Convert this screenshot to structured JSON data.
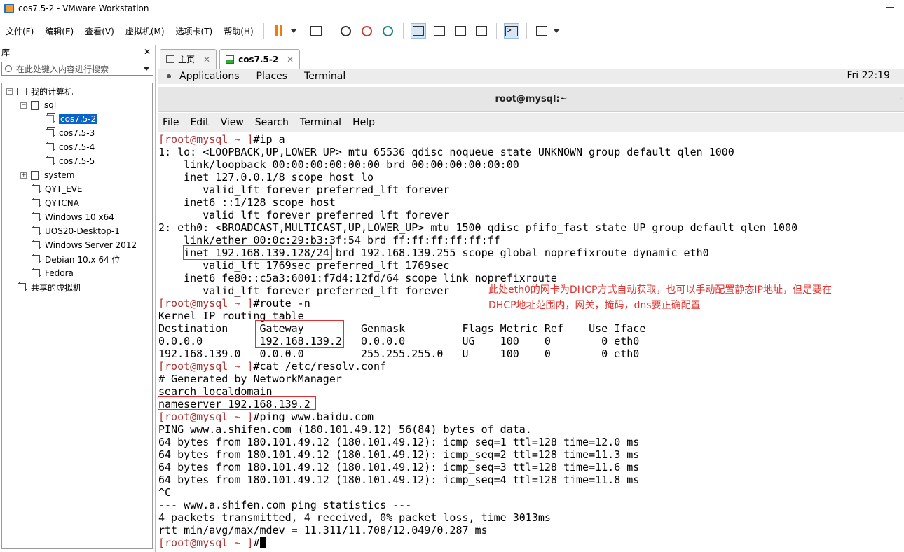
{
  "window": {
    "title": "cos7.5-2 - VMware Workstation"
  },
  "menu": [
    "文件(F)",
    "编辑(E)",
    "查看(V)",
    "虚拟机(M)",
    "选项卡(T)",
    "帮助(H)"
  ],
  "library": {
    "title": "库",
    "close": "✕",
    "search_placeholder": "在此处键入内容进行搜索",
    "my_computer": "我的计算机",
    "sql_folder": "sql",
    "sql_vms": [
      "cos7.5-2",
      "cos7.5-3",
      "cos7.5-4",
      "cos7.5-5"
    ],
    "system_folder": "system",
    "vms": [
      "QYT_EVE",
      "QYTCNA",
      "Windows 10 x64",
      "UOS20-Desktop-1",
      "Windows Server 2012",
      "Debian 10.x 64 位",
      "Fedora"
    ],
    "shared": "共享的虚拟机"
  },
  "tabs": [
    {
      "label": "主页",
      "close": "✕"
    },
    {
      "label": "cos7.5-2",
      "close": "✕"
    }
  ],
  "guest_bar": {
    "applications": "Applications",
    "places": "Places",
    "terminal": "Terminal",
    "clock": "Fri 22:19"
  },
  "terminal_window": {
    "title": "root@mysql:~",
    "minimize": "-",
    "menu": [
      "File",
      "Edit",
      "View",
      "Search",
      "Terminal",
      "Help"
    ]
  },
  "terminal_lines": [
    {
      "prompt": "[root@mysql ~ ]",
      "text": "#ip a"
    },
    {
      "text": "1: lo: <LOOPBACK,UP,LOWER_UP> mtu 65536 qdisc noqueue state UNKNOWN group default qlen 1000"
    },
    {
      "text": "    link/loopback 00:00:00:00:00:00 brd 00:00:00:00:00:00"
    },
    {
      "text": "    inet 127.0.0.1/8 scope host lo"
    },
    {
      "text": "       valid_lft forever preferred_lft forever"
    },
    {
      "text": "    inet6 ::1/128 scope host"
    },
    {
      "text": "       valid_lft forever preferred_lft forever"
    },
    {
      "text": "2: eth0: <BROADCAST,MULTICAST,UP,LOWER_UP> mtu 1500 qdisc pfifo_fast state UP group default qlen 1000"
    },
    {
      "text": "    link/ether 00:0c:29:b3:3f:54 brd ff:ff:ff:ff:ff:ff"
    },
    {
      "text": "    inet 192.168.139.128/24 brd 192.168.139.255 scope global noprefixroute dynamic eth0"
    },
    {
      "text": "       valid_lft 1769sec preferred_lft 1769sec"
    },
    {
      "text": "    inet6 fe80::c5a3:6001:f7d4:12fd/64 scope link noprefixroute"
    },
    {
      "text": "       valid_lft forever preferred_lft forever"
    },
    {
      "prompt": "[root@mysql ~ ]",
      "text": "#route -n"
    },
    {
      "text": "Kernel IP routing table"
    },
    {
      "text": "Destination     Gateway         Genmask         Flags Metric Ref    Use Iface"
    },
    {
      "text": "0.0.0.0         192.168.139.2   0.0.0.0         UG    100    0        0 eth0"
    },
    {
      "text": "192.168.139.0   0.0.0.0         255.255.255.0   U     100    0        0 eth0"
    },
    {
      "prompt": "[root@mysql ~ ]",
      "text": "#cat /etc/resolv.conf"
    },
    {
      "text": "# Generated by NetworkManager"
    },
    {
      "text": "search localdomain"
    },
    {
      "text": "nameserver 192.168.139.2"
    },
    {
      "prompt": "[root@mysql ~ ]",
      "text": "#ping www.baidu.com"
    },
    {
      "text": "PING www.a.shifen.com (180.101.49.12) 56(84) bytes of data."
    },
    {
      "text": "64 bytes from 180.101.49.12 (180.101.49.12): icmp_seq=1 ttl=128 time=12.0 ms"
    },
    {
      "text": "64 bytes from 180.101.49.12 (180.101.49.12): icmp_seq=2 ttl=128 time=11.3 ms"
    },
    {
      "text": "64 bytes from 180.101.49.12 (180.101.49.12): icmp_seq=3 ttl=128 time=11.6 ms"
    },
    {
      "text": "64 bytes from 180.101.49.12 (180.101.49.12): icmp_seq=4 ttl=128 time=11.8 ms"
    },
    {
      "text": "^C"
    },
    {
      "text": "--- www.a.shifen.com ping statistics ---"
    },
    {
      "text": "4 packets transmitted, 4 received, 0% packet loss, time 3013ms"
    },
    {
      "text": "rtt min/avg/max/mdev = 11.311/11.708/12.049/0.287 ms"
    },
    {
      "prompt": "[root@mysql ~ ]",
      "text": "#"
    }
  ],
  "annotation": {
    "line1": "此处eth0的网卡为DHCP方式自动获取，也可以手动配置静态IP地址，但是要在",
    "line2": "DHCP地址范围内，网关，掩码，dns要正确配置"
  },
  "colors": {
    "prompt": "#b03030",
    "annotation": "#e0322e",
    "highlight_box": "#e03030",
    "selection": "#0a64c8"
  }
}
